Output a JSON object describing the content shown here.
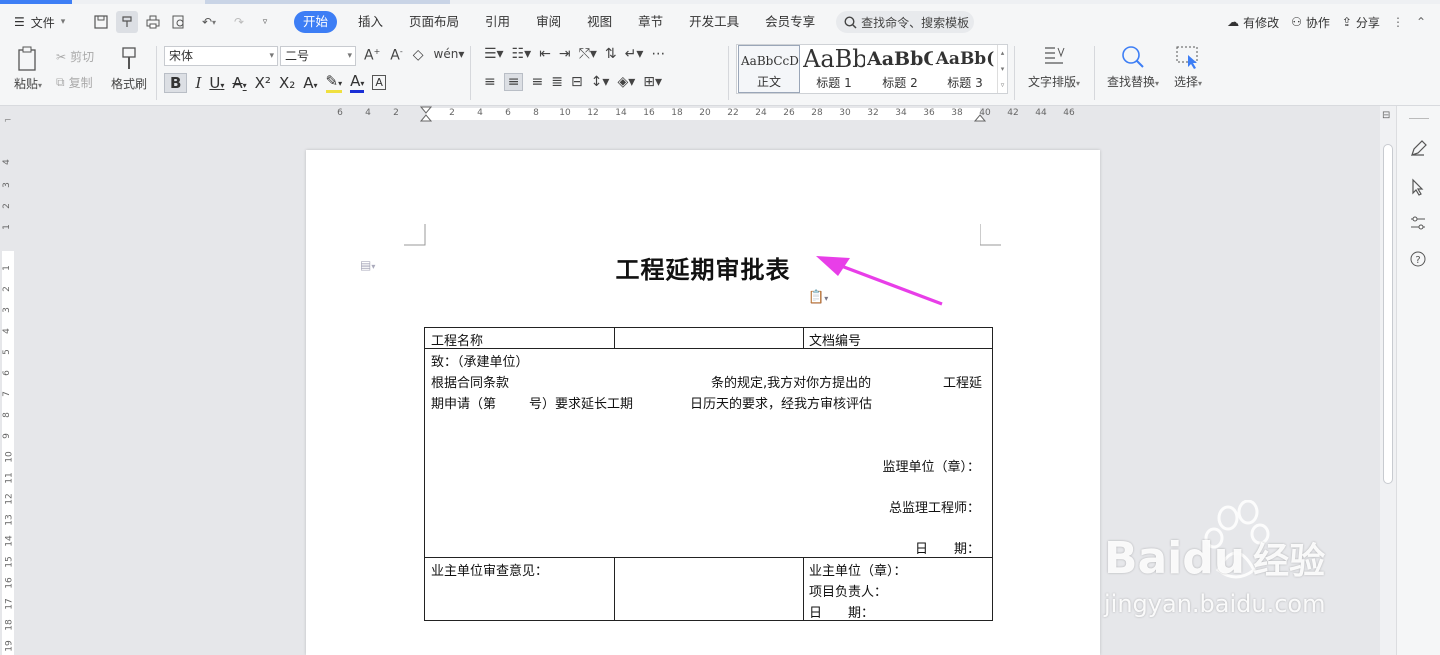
{
  "menubar": {
    "file_label": "文件",
    "tabs": [
      "开始",
      "插入",
      "页面布局",
      "引用",
      "审阅",
      "视图",
      "章节",
      "开发工具",
      "会员专享"
    ],
    "active_tab": "开始",
    "search_placeholder": "查找命令、搜索模板",
    "right": {
      "modified": "有修改",
      "collab": "协作",
      "share": "分享"
    }
  },
  "ribbon": {
    "paste": "粘贴",
    "cut": "剪切",
    "copy": "复制",
    "format_painter": "格式刷",
    "font_name": "宋体",
    "font_size": "二号",
    "styles": [
      {
        "preview": "AaBbCcDd",
        "name": "正文"
      },
      {
        "preview": "AaBb",
        "name": "标题 1"
      },
      {
        "preview": "AaBbC",
        "name": "标题 2"
      },
      {
        "preview": "AaBb(",
        "name": "标题 3"
      }
    ],
    "text_layout": "文字排版",
    "find_replace": "查找替换",
    "select": "选择"
  },
  "hruler_marks": [
    "6",
    "4",
    "2",
    "2",
    "4",
    "6",
    "8",
    "10",
    "12",
    "14",
    "16",
    "18",
    "20",
    "22",
    "24",
    "26",
    "28",
    "30",
    "32",
    "34",
    "36",
    "38",
    "40",
    "42",
    "44",
    "46"
  ],
  "vruler_marks": [
    "4",
    "3",
    "2",
    "1",
    "1",
    "2",
    "3",
    "4",
    "5",
    "6",
    "7",
    "8",
    "9",
    "10",
    "11",
    "12",
    "13",
    "14",
    "15",
    "16",
    "17",
    "18",
    "19"
  ],
  "document": {
    "title": "工程延期审批表",
    "table": {
      "project_name_label": "工程名称",
      "doc_no_label": "文档编号",
      "to_line": "致：（承建单位）",
      "p1_a": "根据合同条款",
      "p1_b": "条的规定,我方对你方提出的",
      "p1_c": "工程延",
      "p2_a": "期申请（第",
      "p2_b": "号）要求延长工期",
      "p2_c": "日历天的要求，经我方审核评估",
      "supervisor_unit": "监理单位（章）：",
      "chief_engineer": "总监理工程师：",
      "date_label": "日　　期：",
      "owner_opinion": "业主单位审查意见：",
      "owner_unit": "业主单位（章）：",
      "project_lead": "项目负责人：",
      "owner_date": "日　　期："
    }
  },
  "watermark": {
    "brand": "Baidu",
    "cn": "经验",
    "url": "jingyan.baidu.com"
  },
  "colors": {
    "accent": "#3d7ef5",
    "arrow": "#e83ee8"
  }
}
